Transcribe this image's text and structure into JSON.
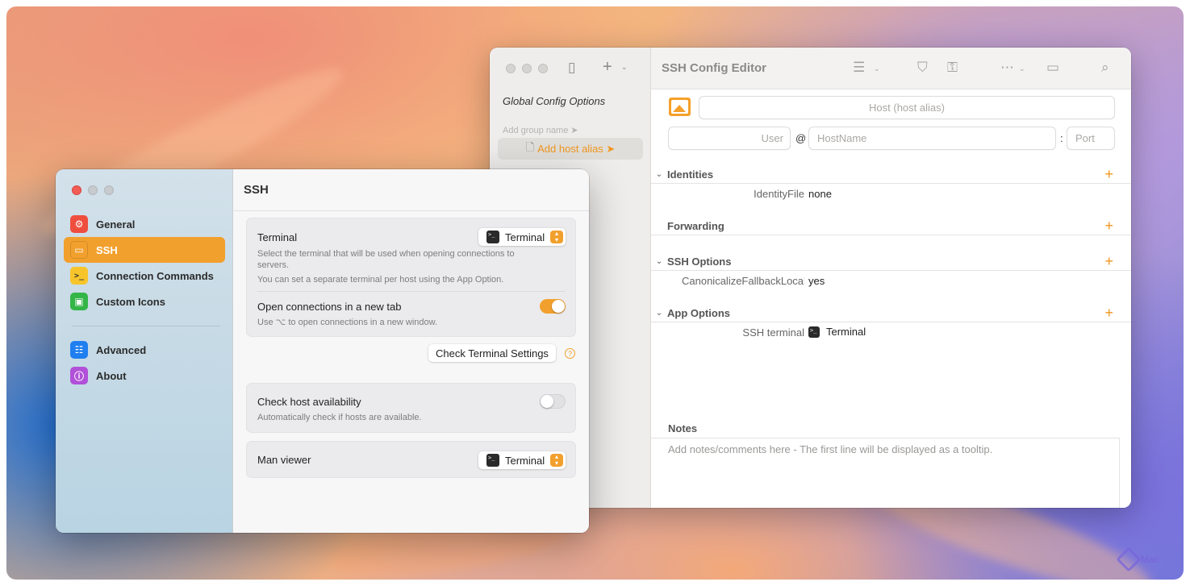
{
  "colors": {
    "accent": "#f2a02d",
    "accent_text": "#f0961d"
  },
  "watermark": {
    "label": "Mac"
  },
  "config_editor": {
    "title": "SSH Config Editor",
    "sidebar": {
      "global_options": "Global Config Options",
      "group_placeholder": "Add group name ➤",
      "host_alias": "Add host alias ➤"
    },
    "fields": {
      "host_placeholder": "Host (host alias)",
      "user_placeholder": "User",
      "at": "@",
      "hostname_placeholder": "HostName",
      "colon": ":",
      "port_placeholder": "Port"
    },
    "sections": [
      {
        "title": "Identities",
        "rows": [
          {
            "key": "IdentityFile",
            "value": "none"
          }
        ]
      },
      {
        "title": "Forwarding",
        "rows": []
      },
      {
        "title": "SSH Options",
        "rows": [
          {
            "key": "CanonicalizeFallbackLocal",
            "value": "yes"
          }
        ]
      },
      {
        "title": "App Options",
        "rows": [
          {
            "key": "SSH terminal",
            "value": "Terminal",
            "icon": "terminal-icon"
          }
        ]
      }
    ],
    "notes": {
      "label": "Notes",
      "placeholder": "Add notes/comments here - The first line will be displayed as a tooltip."
    }
  },
  "settings": {
    "nav": [
      {
        "label": "General",
        "icon": "gear-icon",
        "color": "#ef4e3f"
      },
      {
        "label": "SSH",
        "icon": "monitor-icon",
        "color": "#f2a02d",
        "active": true
      },
      {
        "label": "Connection Commands",
        "icon": "prompt-icon",
        "color": "#f7c52b"
      },
      {
        "label": "Custom Icons",
        "icon": "photo-icon",
        "color": "#34b548"
      },
      {
        "label": "Advanced",
        "icon": "sliders-icon",
        "color": "#1f7ff0"
      },
      {
        "label": "About",
        "icon": "info-icon",
        "color": "#b150d8"
      }
    ],
    "page_title": "SSH",
    "terminal": {
      "title": "Terminal",
      "desc1": "Select the terminal that will be used when opening connections to servers.",
      "desc2": "You can set a separate terminal per host using the App Option.",
      "selected": "Terminal"
    },
    "new_tab": {
      "title": "Open connections in a new tab",
      "desc": "Use ⌥ to open connections in a new window.",
      "enabled": true
    },
    "check_terminal_button": "Check Terminal Settings",
    "host_availability": {
      "title": "Check host availability",
      "desc": "Automatically check if hosts are available.",
      "enabled": false
    },
    "man_viewer": {
      "title": "Man viewer",
      "selected": "Terminal"
    }
  }
}
